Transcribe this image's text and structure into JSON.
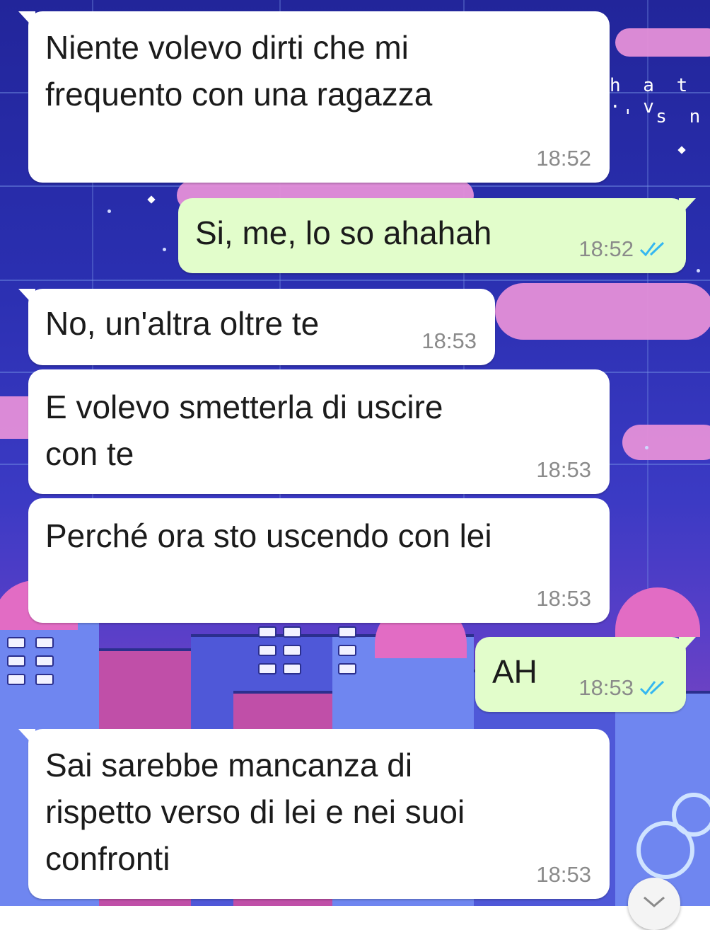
{
  "background": {
    "corner_text_line1": "h a t · v",
    "corner_text_line2": "' s   n"
  },
  "messages": [
    {
      "direction": "in",
      "text": "Niente volevo dirti che mi\nfrequento con una ragazza",
      "time": "18:52"
    },
    {
      "direction": "out",
      "text": "Si, me, lo so ahahah",
      "time": "18:52",
      "status": "read-double-check-icon"
    },
    {
      "direction": "in",
      "text": "No, un'altra oltre te",
      "time": "18:53"
    },
    {
      "direction": "in",
      "text": "E volevo smetterla di uscire\ncon te",
      "time": "18:53"
    },
    {
      "direction": "in",
      "text": "Perché ora sto uscendo con lei",
      "time": "18:53"
    },
    {
      "direction": "out",
      "text": "AH",
      "time": "18:53",
      "status": "read-double-check-icon"
    },
    {
      "direction": "in",
      "text": "Sai sarebbe mancanza di\nrispetto verso di lei e nei suoi\nconfronti",
      "time": "18:53"
    }
  ],
  "colors": {
    "incoming_bubble": "#ffffff",
    "outgoing_bubble": "#e2fdcb",
    "timestamp": "#8a8a8a",
    "read_ticks": "#34b7f1"
  },
  "scroll_button": {
    "icon": "chevron-down-icon"
  }
}
